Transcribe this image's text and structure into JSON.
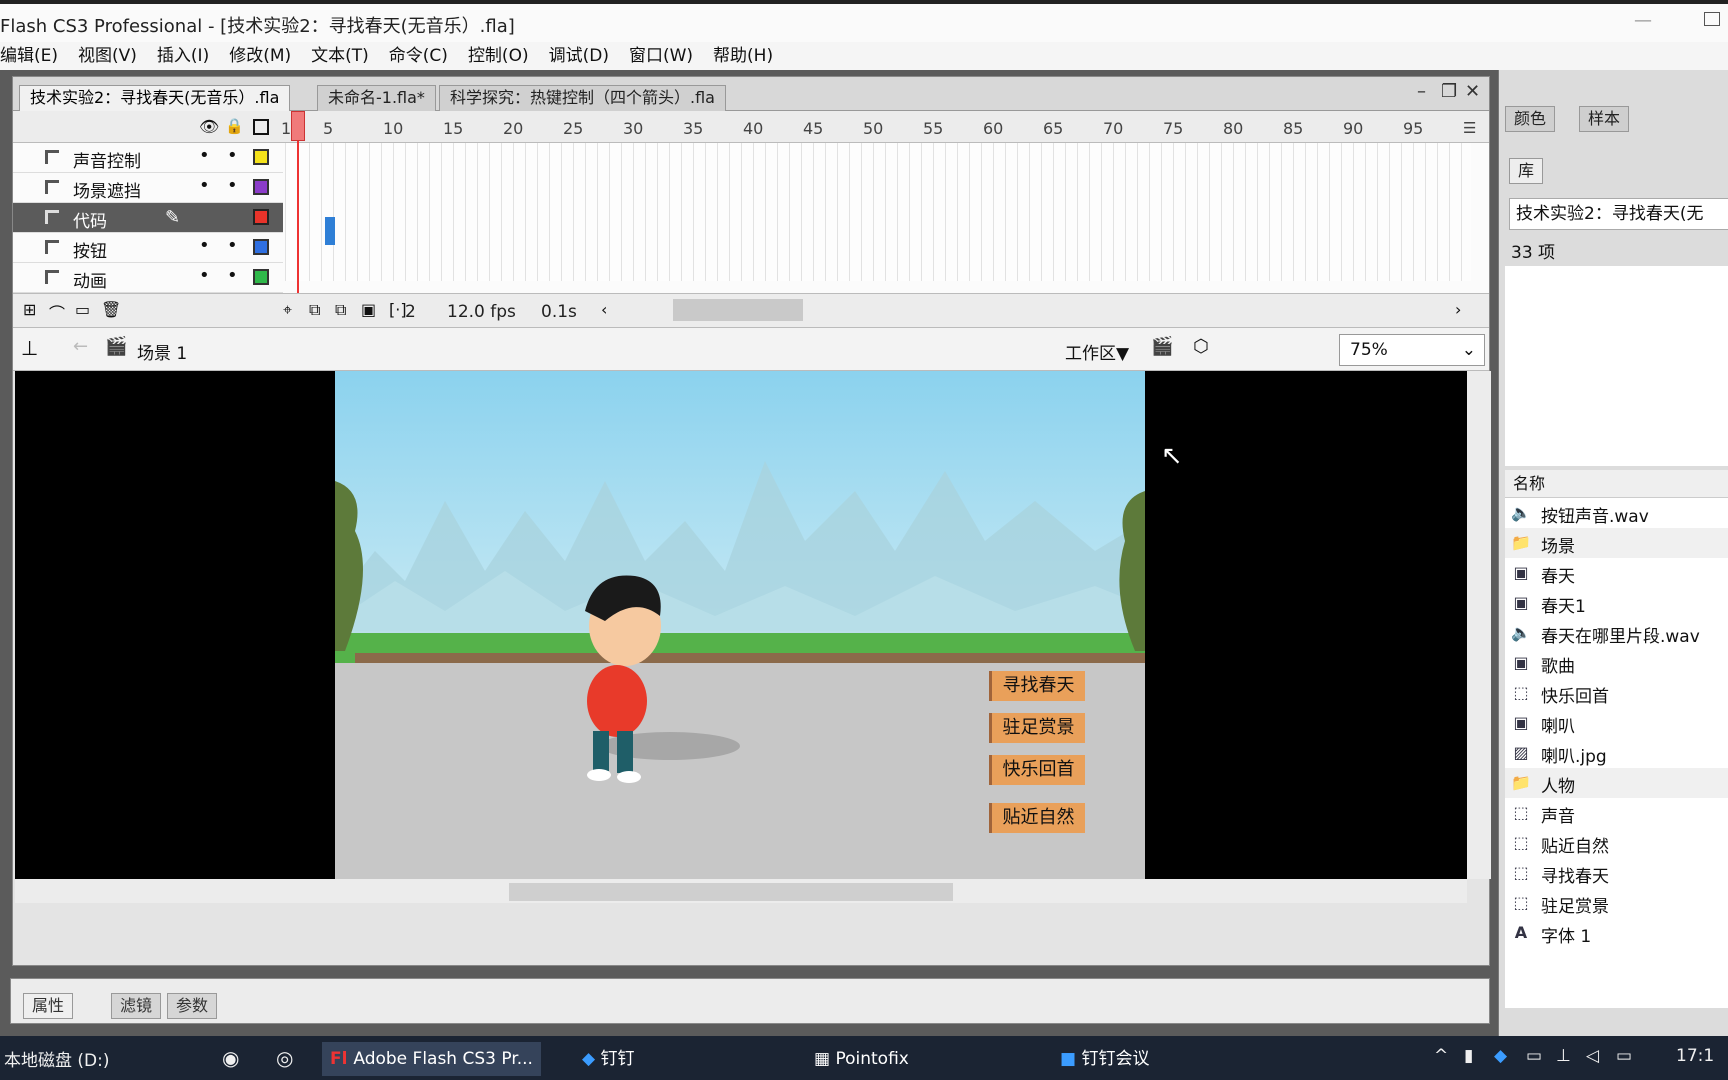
{
  "window": {
    "title": "Flash CS3 Professional - [技术实验2：寻找春天(无音乐）.fla]"
  },
  "menu": [
    "编辑(E)",
    "视图(V)",
    "插入(I)",
    "修改(M)",
    "文本(T)",
    "命令(C)",
    "控制(O)",
    "调试(D)",
    "窗口(W)",
    "帮助(H)"
  ],
  "tabs": [
    "技术实验2：寻找春天(无音乐）.fla",
    "未命名-1.fla*",
    "科学探究：热键控制（四个箭头）.fla"
  ],
  "timeline": {
    "ruler": [
      "1",
      "5",
      "10",
      "15",
      "20",
      "25",
      "30",
      "35",
      "40",
      "45",
      "50",
      "55",
      "60",
      "65",
      "70",
      "75",
      "80",
      "85",
      "90",
      "95"
    ],
    "layers": [
      {
        "name": "声音控制",
        "color": "#f4e21b",
        "selected": false
      },
      {
        "name": "场景遮挡",
        "color": "#8b3cc9",
        "selected": false
      },
      {
        "name": "代码",
        "color": "#e8332a",
        "selected": true
      },
      {
        "name": "按钮",
        "color": "#2f6fe0",
        "selected": false
      },
      {
        "name": "动画",
        "color": "#2fb84a",
        "selected": false
      }
    ],
    "frame": "2",
    "fps": "12.0 fps",
    "time": "0.1s"
  },
  "editbar": {
    "scene": "场景 1",
    "workspace": "工作区▼",
    "zoom": "75%"
  },
  "stage": {
    "buttons": [
      "寻找春天",
      "驻足赏景",
      "快乐回首",
      "贴近自然"
    ]
  },
  "properties": {
    "tabs": [
      "属性",
      "滤镜",
      "参数"
    ]
  },
  "panel": {
    "tabs_top": [
      "颜色",
      "样本"
    ],
    "tab_library": "库",
    "library_select": "技术实验2：寻找春天(无",
    "count": "33 项",
    "column_name": "名称",
    "items": [
      {
        "icon": "sound",
        "name": "按钮声音.wav"
      },
      {
        "icon": "folder",
        "name": "场景"
      },
      {
        "icon": "bitmap",
        "name": "春天"
      },
      {
        "icon": "bitmap",
        "name": "春天1"
      },
      {
        "icon": "sound",
        "name": "春天在哪里片段.wav"
      },
      {
        "icon": "bitmap",
        "name": "歌曲"
      },
      {
        "icon": "button",
        "name": "快乐回首"
      },
      {
        "icon": "bitmap",
        "name": "喇叭"
      },
      {
        "icon": "image",
        "name": "喇叭.jpg"
      },
      {
        "icon": "folder",
        "name": "人物"
      },
      {
        "icon": "button",
        "name": "声音"
      },
      {
        "icon": "button",
        "name": "贴近自然"
      },
      {
        "icon": "button",
        "name": "寻找春天"
      },
      {
        "icon": "button",
        "name": "驻足赏景"
      },
      {
        "icon": "font",
        "name": "字体 1"
      }
    ]
  },
  "taskbar": {
    "drive": "本地磁盘 (D:)",
    "apps": [
      "Adobe Flash CS3 Pr...",
      "钉钉",
      "Pointofix",
      "钉钉会议"
    ],
    "clock": "17:1"
  }
}
